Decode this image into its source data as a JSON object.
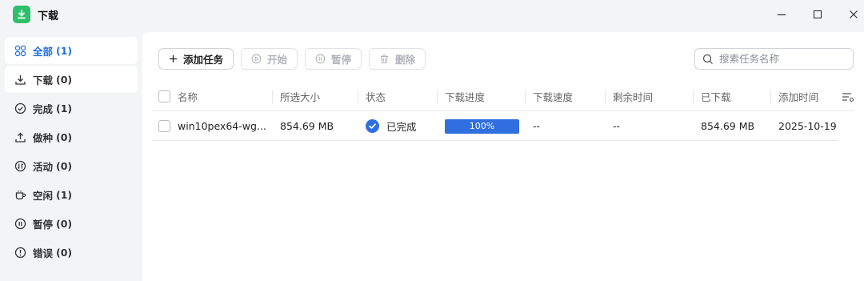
{
  "window": {
    "title": "下载"
  },
  "sidebar": {
    "items": [
      {
        "label": "全部",
        "count": "(1)"
      },
      {
        "label": "下载",
        "count": "(0)"
      },
      {
        "label": "完成",
        "count": "(1)"
      },
      {
        "label": "做种",
        "count": "(0)"
      },
      {
        "label": "活动",
        "count": "(0)"
      },
      {
        "label": "空闲",
        "count": "(1)"
      },
      {
        "label": "暂停",
        "count": "(0)"
      },
      {
        "label": "错误",
        "count": "(0)"
      }
    ]
  },
  "toolbar": {
    "add_task": "添加任务",
    "start": "开始",
    "pause": "暂停",
    "delete": "删除"
  },
  "search": {
    "placeholder": "搜索任务名称"
  },
  "table": {
    "columns": [
      "名称",
      "所选大小",
      "状态",
      "下载进度",
      "下载速度",
      "剩余时间",
      "已下载",
      "添加时间"
    ],
    "rows": [
      {
        "name": "win10pex64-wg...",
        "size": "854.69 MB",
        "status": "已完成",
        "progress_label": "100%",
        "progress": 1.0,
        "speed": "--",
        "remaining": "--",
        "downloaded": "854.69 MB",
        "added": "2025-10-19"
      }
    ]
  },
  "colors": {
    "accent": "#2f6fe0",
    "app_icon": "#2fbf6b"
  }
}
